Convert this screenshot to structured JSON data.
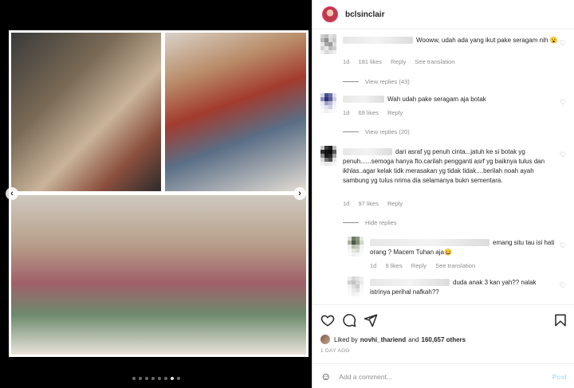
{
  "post": {
    "username": "bclsinclair",
    "likes_prefix": "Liked by",
    "liked_by_user": "novhi_thariend",
    "likes_and": "and",
    "likes_others": "160,657 others",
    "date": "1 DAY AGO",
    "add_comment_placeholder": "Add a comment...",
    "post_label": "Post"
  },
  "carousel": {
    "slide_count": 8,
    "active_index": 6
  },
  "comments": [
    {
      "text": "Wooww, udah ada yang ikut pake seragam nih 😮",
      "age": "1d",
      "likes": "181 likes",
      "reply": "Reply",
      "translation": "See translation",
      "thread": "View replies (43)"
    },
    {
      "text": "Wah udah pake seragam aja botak",
      "age": "1d",
      "likes": "69 likes",
      "reply": "Reply",
      "thread": "View replies (20)"
    },
    {
      "text": "dari asraf yg penuh cinta...jatuh ke si botak yg penuh......semoga hanya fto.carilah pengganti asrf yg baiknya tulus dan ikhlas..agar kelak tidk merasakan yg tidak tidak....berilah noah ayah sambung yg tulus nrima dia selamanya bukn sementara.",
      "age": "1d",
      "likes": "97 likes",
      "reply": "Reply",
      "thread": "Hide replies"
    },
    {
      "text": "emang situ tau isi hati orang ? Macem Tuhan aja😀",
      "age": "1d",
      "likes": "9 likes",
      "reply": "Reply",
      "translation": "See translation"
    },
    {
      "text": "duda anak 3 kan yah?? nalak istrinya perihal nafkah??"
    }
  ],
  "colors": {
    "accent_link": "#b2dffc",
    "muted": "#8e8e8e",
    "text": "#262626"
  }
}
